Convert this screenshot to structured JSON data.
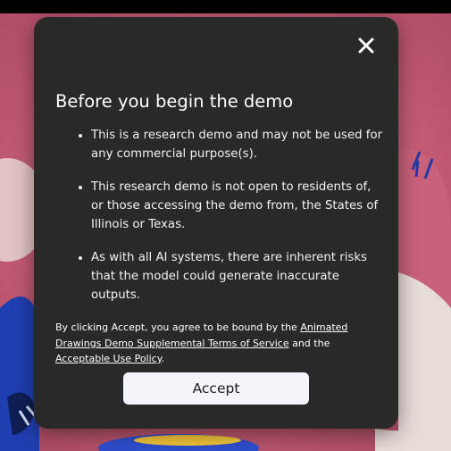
{
  "modal": {
    "title": "Before you begin the demo",
    "bullets": [
      "This is a research demo and may not be used for any commercial purpose(s).",
      "This research demo is not open to residents of, or those accessing the demo from, the States of Illinois or Texas.",
      "As with all AI systems, there are inherent risks that the model could generate inaccurate outputs."
    ],
    "agreement": {
      "prefix": "By clicking Accept, you agree to be bound by the ",
      "terms_link": "Animated Drawings Demo Supplemental Terms of Service",
      "middle": " and the ",
      "policy_link": "Acceptable Use Policy",
      "suffix": "."
    },
    "accept_label": "Accept",
    "close_icon": "close-icon"
  },
  "colors": {
    "modal_bg": "#292929",
    "button_bg": "#f3f5fb",
    "backdrop": "#c8627a",
    "top_bar": "#000000"
  }
}
